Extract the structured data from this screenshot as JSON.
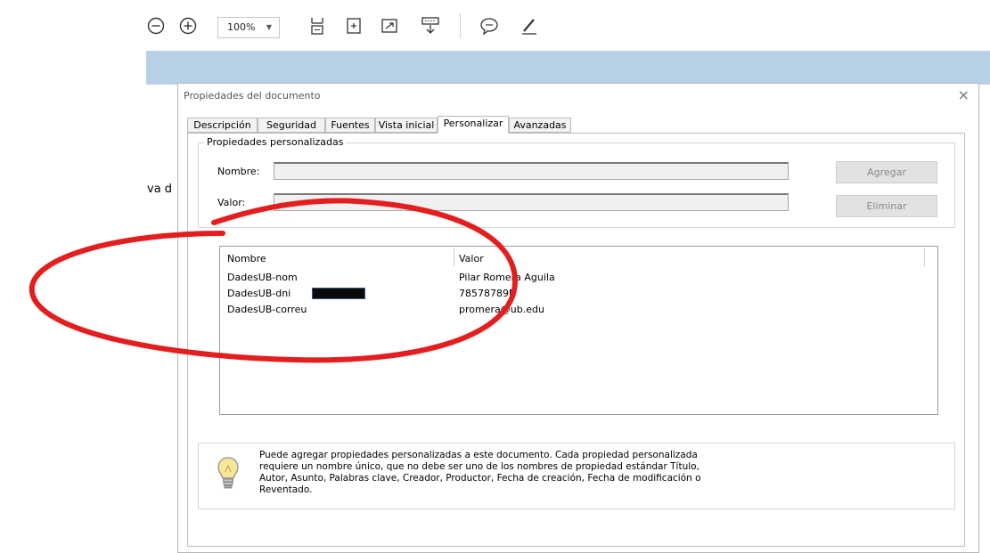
{
  "toolbar": {
    "zoom_value": "100%",
    "icons": [
      "zoom-out-icon",
      "zoom-in-icon",
      "fit-page-icon",
      "fit-width-icon",
      "full-screen-icon",
      "read-mode-icon",
      "comment-icon",
      "highlight-pen-icon"
    ]
  },
  "background": {
    "partial_text": "va d"
  },
  "dialog": {
    "title": "Propiedades del documento",
    "close_glyph": "×",
    "tabs": [
      "Descripción",
      "Seguridad",
      "Fuentes",
      "Vista inicial",
      "Personalizar",
      "Avanzadas"
    ],
    "active_tab": "Personalizar",
    "group_title": "Propiedades personalizadas",
    "name_label": "Nombre:",
    "name_value": "",
    "value_label": "Valor:",
    "value_value": "",
    "add_button": "Agregar",
    "delete_button": "Eliminar",
    "list": {
      "headers": [
        "Nombre",
        "Valor"
      ],
      "rows": [
        {
          "name": "DadesUB-nom",
          "value": "Pilar Romera Aguila"
        },
        {
          "name": "DadesUB-dni",
          "value": "78578789N"
        },
        {
          "name": "DadesUB-correu",
          "value": "promera@ub.edu"
        }
      ]
    },
    "info_text": "Puede agregar propiedades personalizadas a este documento. Cada propiedad personalizada requiere un nombre único, que no debe ser uno de los nombres de propiedad estándar Título, Autor, Asunto, Palabras clave, Creador, Productor, Fecha de creación, Fecha de modificación o Reventado."
  },
  "colors": {
    "annotation_red": "#e41e1e",
    "blue_bar": "#b8d0e6",
    "redaction": "#0a0a0a"
  }
}
